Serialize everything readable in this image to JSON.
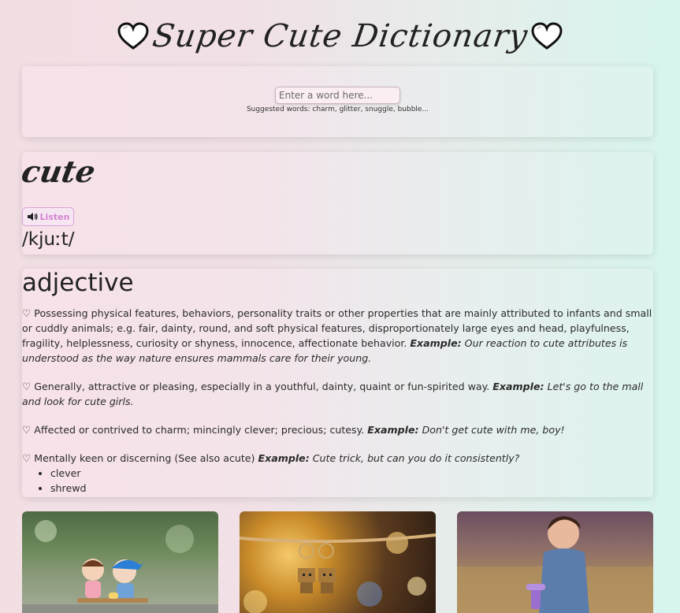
{
  "header": {
    "title": "Super Cute Dictionary",
    "left_icon": "heart-icon",
    "right_icon": "heart-icon"
  },
  "search": {
    "placeholder": "Enter a word here...",
    "suggested": "Suggested words: charm, glitter, snuggle, bubble..."
  },
  "word": {
    "headword": "cute",
    "listen_label": "Listen",
    "listen_icon": "speaker-icon",
    "phonetic": "/kjuːt/"
  },
  "meaning": {
    "part_of_speech": "adjective",
    "definitions": [
      {
        "text": "♡ Possessing physical features, behaviors, personality traits or other properties that are mainly attributed to infants and small or cuddly animals; e.g. fair, dainty, round, and soft physical features, disproportionately large eyes and head, playfulness, fragility, helplessness, curiosity or shyness, innocence, affectionate behavior.",
        "example_label": "Example:",
        "example": "Our reaction to cute attributes is understood as the way nature ensures mammals care for their young."
      },
      {
        "text": "♡ Generally, attractive or pleasing, especially in a youthful, dainty, quaint or fun-spirited way.",
        "example_label": "Example:",
        "example": "Let's go to the mall and look for cute girls."
      },
      {
        "text": "♡ Affected or contrived to charm; mincingly clever; precious; cutesy.",
        "example_label": "Example:",
        "example": "Don't get cute with me, boy!"
      },
      {
        "text": "♡ Mentally keen or discerning (See also acute)",
        "example_label": "Example:",
        "example": "Cute trick, but can you do it consistently?"
      }
    ],
    "synonyms": [
      "clever",
      "shrewd"
    ]
  },
  "images": [
    "figurine-couple-on-swing-photo",
    "hanging-cardboard-robot-keychains-photo",
    "toddler-girl-in-field-photo"
  ],
  "colors": {
    "accent": "#d583d3",
    "background_left": "#f2dfe4",
    "background_right": "#d7f5ee"
  }
}
